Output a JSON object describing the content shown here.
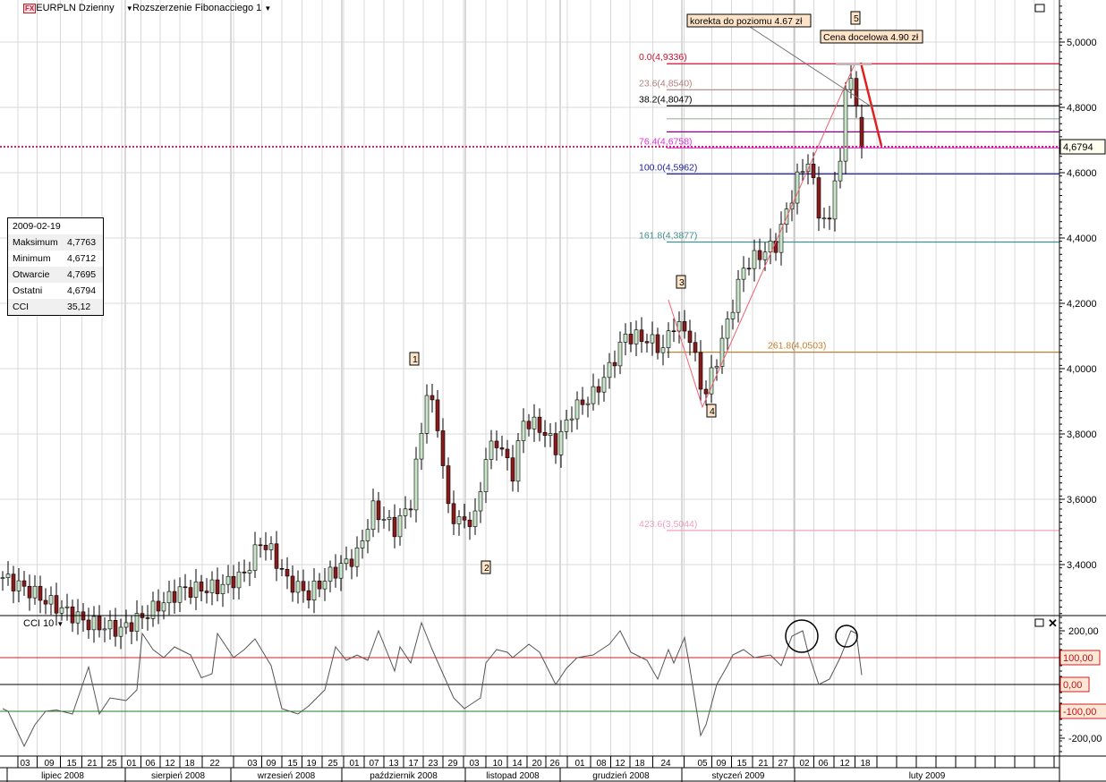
{
  "header": {
    "symbol": "EURPLN Dzienny",
    "study": "Rozszerzenie Fibonacciego 1",
    "fx_logo": "FX"
  },
  "info_box": {
    "date": "2009-02-19",
    "rows": [
      {
        "label": "Maksimum",
        "value": "4,7763"
      },
      {
        "label": "Minimum",
        "value": "4,6712"
      },
      {
        "label": "Otwarcie",
        "value": "4,7695"
      },
      {
        "label": "Ostatni",
        "value": "4,6794"
      },
      {
        "label": "CCI",
        "value": "35,12"
      }
    ]
  },
  "annotations": {
    "correction": "korekta do poziomu 4.67 zł",
    "target": "Cena docelowa 4.90 zł",
    "waves": [
      "1",
      "2",
      "3",
      "4",
      "5"
    ]
  },
  "cci_pane": {
    "title": "CCI 10",
    "ticks": [
      "200,00",
      "-200,00"
    ],
    "levels": [
      {
        "label": "100,00",
        "value": 100,
        "color": "#d02020"
      },
      {
        "label": "0,00",
        "value": 0,
        "color": "#000000"
      },
      {
        "label": "-100,00",
        "value": -100,
        "color": "#208020"
      }
    ]
  },
  "colors": {
    "up": "#c8e6c8",
    "down": "#8b1a1a",
    "last_price": "#e0206a"
  },
  "chart_data": {
    "type": "candlestick",
    "title": "EURPLN Dzienny",
    "ylim": [
      3.244,
      5.13
    ],
    "y_ticks": [
      "5,0000",
      "4,8000",
      "4,6000",
      "4,4000",
      "4,2000",
      "4,0000",
      "3,8000",
      "3,6000",
      "3,4000"
    ],
    "y_tick_values": [
      5.0,
      4.8,
      4.6,
      4.4,
      4.2,
      4.0,
      3.8,
      3.6,
      3.4
    ],
    "last_price": {
      "label": "4,6794",
      "value": 4.6794
    },
    "close_anchors": [
      [
        0,
        3.36
      ],
      [
        5,
        3.32
      ],
      [
        8,
        3.29
      ],
      [
        16,
        3.22
      ],
      [
        22,
        3.2
      ],
      [
        26,
        3.24
      ],
      [
        33,
        3.32
      ],
      [
        40,
        3.33
      ],
      [
        45,
        3.37
      ],
      [
        48,
        3.47
      ],
      [
        50,
        3.44
      ],
      [
        53,
        3.35
      ],
      [
        57,
        3.31
      ],
      [
        61,
        3.37
      ],
      [
        66,
        3.43
      ],
      [
        69,
        3.57
      ],
      [
        73,
        3.51
      ],
      [
        76,
        3.59
      ],
      [
        78,
        3.81
      ],
      [
        79,
        3.93
      ],
      [
        81,
        3.83
      ],
      [
        83,
        3.57
      ],
      [
        85,
        3.53
      ],
      [
        88,
        3.54
      ],
      [
        90,
        3.73
      ],
      [
        92,
        3.78
      ],
      [
        95,
        3.68
      ],
      [
        97,
        3.84
      ],
      [
        100,
        3.82
      ],
      [
        103,
        3.76
      ],
      [
        106,
        3.87
      ],
      [
        110,
        3.92
      ],
      [
        113,
        4.0
      ],
      [
        116,
        4.1
      ],
      [
        120,
        4.09
      ],
      [
        123,
        4.06
      ],
      [
        125,
        4.14
      ],
      [
        128,
        4.1
      ],
      [
        130,
        3.95
      ],
      [
        131,
        3.93
      ],
      [
        133,
        4.03
      ],
      [
        135,
        4.14
      ],
      [
        138,
        4.31
      ],
      [
        141,
        4.35
      ],
      [
        144,
        4.38
      ],
      [
        148,
        4.58
      ],
      [
        150,
        4.64
      ],
      [
        152,
        4.48
      ],
      [
        154,
        4.44
      ],
      [
        155,
        4.6
      ],
      [
        156,
        4.62
      ],
      [
        157,
        4.85
      ],
      [
        158,
        4.91
      ],
      [
        159,
        4.78
      ],
      [
        160,
        4.68
      ]
    ],
    "cci_anchors": [
      [
        0,
        -90
      ],
      [
        1,
        -100
      ],
      [
        4,
        -230
      ],
      [
        6,
        -150
      ],
      [
        8,
        -100
      ],
      [
        10,
        -95
      ],
      [
        13,
        -110
      ],
      [
        16,
        65
      ],
      [
        18,
        -110
      ],
      [
        20,
        -50
      ],
      [
        23,
        -60
      ],
      [
        25,
        -20
      ],
      [
        26,
        190
      ],
      [
        28,
        130
      ],
      [
        30,
        100
      ],
      [
        32,
        140
      ],
      [
        35,
        110
      ],
      [
        37,
        25
      ],
      [
        39,
        40
      ],
      [
        40,
        190
      ],
      [
        43,
        100
      ],
      [
        45,
        130
      ],
      [
        47,
        170
      ],
      [
        50,
        70
      ],
      [
        52,
        -90
      ],
      [
        55,
        -110
      ],
      [
        57,
        -80
      ],
      [
        60,
        -20
      ],
      [
        62,
        140
      ],
      [
        64,
        90
      ],
      [
        66,
        110
      ],
      [
        68,
        90
      ],
      [
        70,
        200
      ],
      [
        72,
        100
      ],
      [
        73,
        50
      ],
      [
        74,
        140
      ],
      [
        76,
        80
      ],
      [
        78,
        230
      ],
      [
        80,
        130
      ],
      [
        82,
        40
      ],
      [
        84,
        -50
      ],
      [
        86,
        -90
      ],
      [
        89,
        -50
      ],
      [
        90,
        80
      ],
      [
        92,
        130
      ],
      [
        94,
        120
      ],
      [
        95,
        100
      ],
      [
        98,
        150
      ],
      [
        100,
        120
      ],
      [
        103,
        0
      ],
      [
        105,
        60
      ],
      [
        107,
        100
      ],
      [
        110,
        110
      ],
      [
        113,
        150
      ],
      [
        115,
        200
      ],
      [
        117,
        120
      ],
      [
        120,
        90
      ],
      [
        122,
        20
      ],
      [
        124,
        130
      ],
      [
        125,
        80
      ],
      [
        127,
        175
      ],
      [
        128,
        60
      ],
      [
        130,
        -190
      ],
      [
        131,
        -150
      ],
      [
        133,
        0
      ],
      [
        135,
        70
      ],
      [
        136,
        110
      ],
      [
        138,
        130
      ],
      [
        140,
        100
      ],
      [
        143,
        110
      ],
      [
        145,
        70
      ],
      [
        147,
        180
      ],
      [
        149,
        200
      ],
      [
        150,
        120
      ],
      [
        152,
        0
      ],
      [
        154,
        20
      ],
      [
        156,
        100
      ],
      [
        158,
        200
      ],
      [
        159,
        190
      ],
      [
        160,
        35
      ]
    ],
    "fibonacci": [
      {
        "label": "0.0(4,9336)",
        "value": 4.9336,
        "color": "#d01030"
      },
      {
        "label": "23.6(4,8540)",
        "value": 4.854,
        "color": "#b08080"
      },
      {
        "label": "38.2(4,8047)",
        "value": 4.8047,
        "color": "#000000"
      },
      {
        "label": "",
        "value": 4.7649,
        "color": "#a0b0a0"
      },
      {
        "label": "",
        "value": 4.725,
        "color": "#800080"
      },
      {
        "label": "76.4(4,6758)",
        "value": 4.6758,
        "color": "#e030e0"
      },
      {
        "label": "100.0(4,5962)",
        "value": 4.5962,
        "color": "#2020a0"
      },
      {
        "label": "161.8(4,3877)",
        "value": 4.3877,
        "color": "#409090"
      },
      {
        "label": "261.8(4,0503)",
        "value": 4.0503,
        "color": "#c08030"
      },
      {
        "label": "423.6(3,5044)",
        "value": 3.5044,
        "color": "#f0a0c0"
      }
    ],
    "x_days": [
      "03",
      "09",
      "15",
      "21",
      "25",
      "01",
      "06",
      "12",
      "18",
      "22",
      "03",
      "09",
      "15",
      "19",
      "25",
      "01",
      "07",
      "13",
      "17",
      "23",
      "29",
      "03",
      "10",
      "14",
      "20",
      "26",
      "01",
      "08",
      "12",
      "18",
      "24",
      "05",
      "09",
      "15",
      "21",
      "27",
      "02",
      "06",
      "12",
      "18"
    ],
    "x_months": [
      "lipiec 2008",
      "sierpień 2008",
      "wrzesień 2008",
      "październik 2008",
      "listopad 2008",
      "grudzień 2008",
      "styczeń 2009",
      "luty 2009"
    ]
  }
}
